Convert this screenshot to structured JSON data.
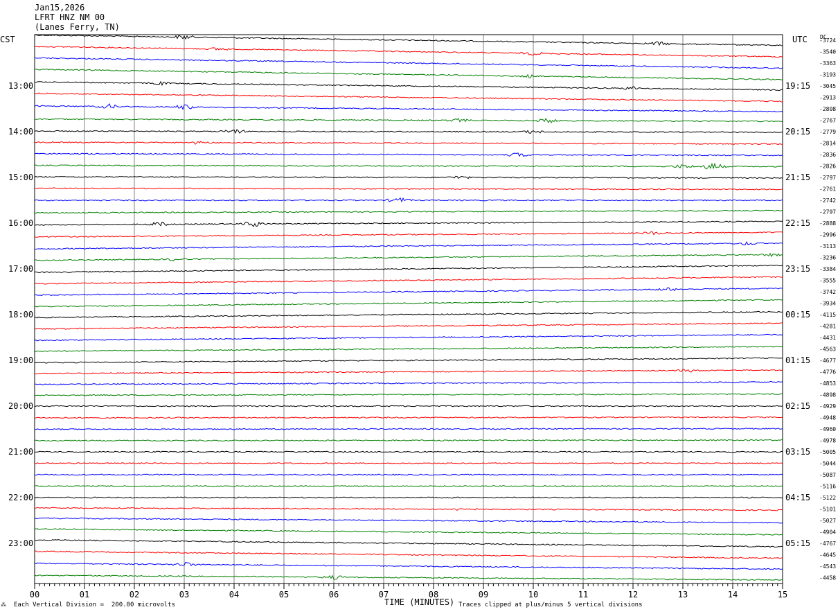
{
  "header": {
    "date": "Jan15,2026",
    "station": "LFRT HNZ NM 00",
    "location": "(Lanes Ferry, TN)"
  },
  "left_tz": "CST",
  "right_tz": "UTC",
  "dc_label": "DC",
  "footer": {
    "scale_note": "Each Vertical Division =  200.00 microvolts",
    "xlabel": "TIME (MINUTES)",
    "clip_note": "Traces clipped at plus/minus 5 vertical divisions"
  },
  "colors": {
    "trace_cycle": [
      "#000000",
      "#ff0000",
      "#0000ff",
      "#007f00"
    ],
    "grid": "#808080",
    "frame": "#000000"
  },
  "chart_data": {
    "type": "line",
    "title": "LFRT HNZ NM 00",
    "xlabel": "TIME (MINUTES)",
    "x_ticks": [
      "00",
      "01",
      "02",
      "03",
      "04",
      "05",
      "06",
      "07",
      "08",
      "09",
      "10",
      "11",
      "12",
      "13",
      "14",
      "15"
    ],
    "xlim": [
      0,
      15
    ],
    "left_time_labels": [
      "13:00",
      "14:00",
      "15:00",
      "16:00",
      "17:00",
      "18:00",
      "19:00",
      "20:00",
      "21:00",
      "22:00",
      "23:00"
    ],
    "right_time_labels": [
      "19:15",
      "20:15",
      "21:15",
      "22:15",
      "23:15",
      "00:15",
      "01:15",
      "02:15",
      "03:15",
      "04:15",
      "05:15"
    ],
    "dc_offsets": [
      "-3724",
      "-3540",
      "-3363",
      "-3193",
      "-3045",
      "-2913",
      "-2808",
      "-2767",
      "-2779",
      "-2814",
      "-2836",
      "-2826",
      "-2797",
      "-2761",
      "-2742",
      "-2797",
      "-2888",
      "-2996",
      "-3113",
      "-3236",
      "-3384",
      "-3555",
      "-3742",
      "-3934",
      "-4115",
      "-4281",
      "-4431",
      "-4563",
      "-4677",
      "-4776",
      "-4853",
      "-4898",
      "-4929",
      "-4948",
      "-4960",
      "-4978",
      "-5005",
      "-5044",
      "-5087",
      "-5116",
      "-5122",
      "-5101",
      "-5027",
      "-4904",
      "-4767",
      "-4645",
      "-4543",
      "-4458"
    ],
    "trace_drift_divisions": [
      0.9,
      0.9,
      0.9,
      0.9,
      0.7,
      0.7,
      0.5,
      0.2,
      0.1,
      0.15,
      0.15,
      0.1,
      0.1,
      0.1,
      0,
      -0.2,
      -0.3,
      -0.4,
      -0.5,
      -0.5,
      -0.6,
      -0.6,
      -0.6,
      -0.6,
      -0.5,
      -0.5,
      -0.5,
      -0.4,
      -0.4,
      -0.3,
      -0.2,
      -0.1,
      0,
      -0.05,
      -0.05,
      -0.05,
      0,
      0,
      0,
      0,
      0,
      0.2,
      0.4,
      0.5,
      0.6,
      0.6,
      0.5,
      0.4
    ],
    "events": [
      {
        "trace": 0,
        "minute": 3.0,
        "amp": 3
      },
      {
        "trace": 0,
        "minute": 12.5,
        "amp": 2.5
      },
      {
        "trace": 1,
        "minute": 3.7,
        "amp": 2
      },
      {
        "trace": 1,
        "minute": 10.0,
        "amp": 2
      },
      {
        "trace": 3,
        "minute": 9.9,
        "amp": 3
      },
      {
        "trace": 4,
        "minute": 2.5,
        "amp": 2
      },
      {
        "trace": 4,
        "minute": 12.0,
        "amp": 2
      },
      {
        "trace": 6,
        "minute": 1.5,
        "amp": 3
      },
      {
        "trace": 6,
        "minute": 3.0,
        "amp": 3
      },
      {
        "trace": 7,
        "minute": 10.3,
        "amp": 3
      },
      {
        "trace": 7,
        "minute": 8.5,
        "amp": 2
      },
      {
        "trace": 8,
        "minute": 4.0,
        "amp": 3
      },
      {
        "trace": 8,
        "minute": 10.0,
        "amp": 2
      },
      {
        "trace": 9,
        "minute": 3.3,
        "amp": 2
      },
      {
        "trace": 10,
        "minute": 9.7,
        "amp": 2.5
      },
      {
        "trace": 11,
        "minute": 13.6,
        "amp": 5
      },
      {
        "trace": 11,
        "minute": 13.0,
        "amp": 2.5
      },
      {
        "trace": 12,
        "minute": 8.5,
        "amp": 2
      },
      {
        "trace": 14,
        "minute": 7.3,
        "amp": 3.5
      },
      {
        "trace": 16,
        "minute": 4.4,
        "amp": 4
      },
      {
        "trace": 16,
        "minute": 2.5,
        "amp": 3
      },
      {
        "trace": 17,
        "minute": 12.4,
        "amp": 2
      },
      {
        "trace": 18,
        "minute": 14.3,
        "amp": 2
      },
      {
        "trace": 19,
        "minute": 2.8,
        "amp": 2
      },
      {
        "trace": 19,
        "minute": 14.8,
        "amp": 2
      },
      {
        "trace": 22,
        "minute": 12.7,
        "amp": 2
      },
      {
        "trace": 29,
        "minute": 13.1,
        "amp": 2
      },
      {
        "trace": 41,
        "minute": 8.6,
        "amp": 2
      },
      {
        "trace": 46,
        "minute": 3.0,
        "amp": 3
      },
      {
        "trace": 47,
        "minute": 6.0,
        "amp": 2.5
      }
    ]
  }
}
